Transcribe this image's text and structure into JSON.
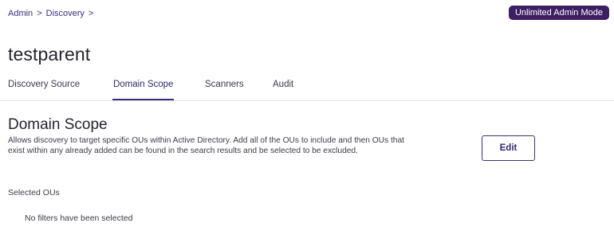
{
  "breadcrumb": {
    "items": [
      "Admin",
      "Discovery"
    ],
    "separator": ">"
  },
  "admin_mode_badge": "Unlimited Admin Mode",
  "page_title": "testparent",
  "tabs": [
    {
      "label": "Discovery Source",
      "active": false
    },
    {
      "label": "Domain Scope",
      "active": true
    },
    {
      "label": "Scanners",
      "active": false
    },
    {
      "label": "Audit",
      "active": false
    }
  ],
  "section": {
    "title": "Domain Scope",
    "description": "Allows discovery to target specific OUs within Active Directory. Add all of the OUs to include and then OUs that exist within any already added can be found in the search results and be selected to be excluded.",
    "edit_label": "Edit",
    "selected_label": "Selected OUs",
    "empty_text": "No filters have been selected"
  },
  "colors": {
    "accent": "#3b2f7a",
    "badge_bg": "#3e1f63",
    "text": "#2b2b38"
  }
}
